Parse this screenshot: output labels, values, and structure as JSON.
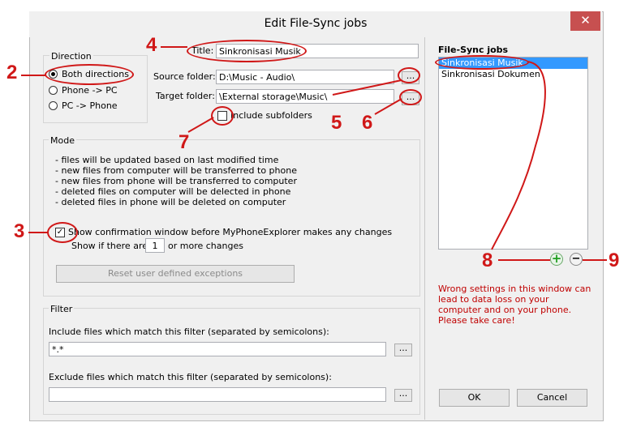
{
  "window": {
    "title": "Edit File-Sync jobs",
    "close_glyph": "✕"
  },
  "direction": {
    "legend": "Direction",
    "options": [
      "Both directions",
      "Phone -> PC",
      "PC -> Phone"
    ],
    "selected": "Both directions"
  },
  "title_field": {
    "label": "Title:",
    "value": "Sinkronisasi Musik"
  },
  "source": {
    "label": "Source folder:",
    "value": "D:\\Music - Audio\\",
    "browse": "..."
  },
  "target": {
    "label": "Target folder:",
    "value": "\\External storage\\Music\\",
    "browse": "..."
  },
  "subfolders": {
    "label": "Include subfolders",
    "checked": false
  },
  "mode": {
    "legend": "Mode",
    "lines": [
      "- files will be updated based on last modified time",
      "- new files from computer will be transferred to phone",
      "- new files from phone will be transferred to computer",
      "- deleted files on computer will be delected in phone",
      "- deleted files in phone will be deleted on computer"
    ],
    "confirm_label": "Show confirmation window before MyPhoneExplorer makes any changes",
    "confirm_checked": true,
    "show_prefix": "Show if there are",
    "show_value": "1",
    "show_suffix": "or more changes",
    "reset_button": "Reset user defined exceptions"
  },
  "filter": {
    "legend": "Filter",
    "include_label": "Include files which match this filter (separated by semicolons):",
    "include_value": "*.*",
    "exclude_label": "Exclude files which match this filter (separated by semicolons):",
    "exclude_value": "",
    "browse": "..."
  },
  "jobs": {
    "heading": "File-Sync jobs",
    "items": [
      "Sinkronisasi Musik",
      "Sinkronisasi Dokumen"
    ],
    "selected": "Sinkronisasi Musik",
    "add": "+",
    "remove": "−"
  },
  "warning": "Wrong settings in this window can lead to data loss on your computer and on your phone. Please take care!",
  "buttons": {
    "ok": "OK",
    "cancel": "Cancel"
  },
  "annotations": [
    "2",
    "3",
    "4",
    "5",
    "6",
    "7",
    "8",
    "9"
  ],
  "colors": {
    "annotation": "#d01818",
    "selection": "#3399ff",
    "warning": "#c00000",
    "add": "#1f9e1f"
  }
}
